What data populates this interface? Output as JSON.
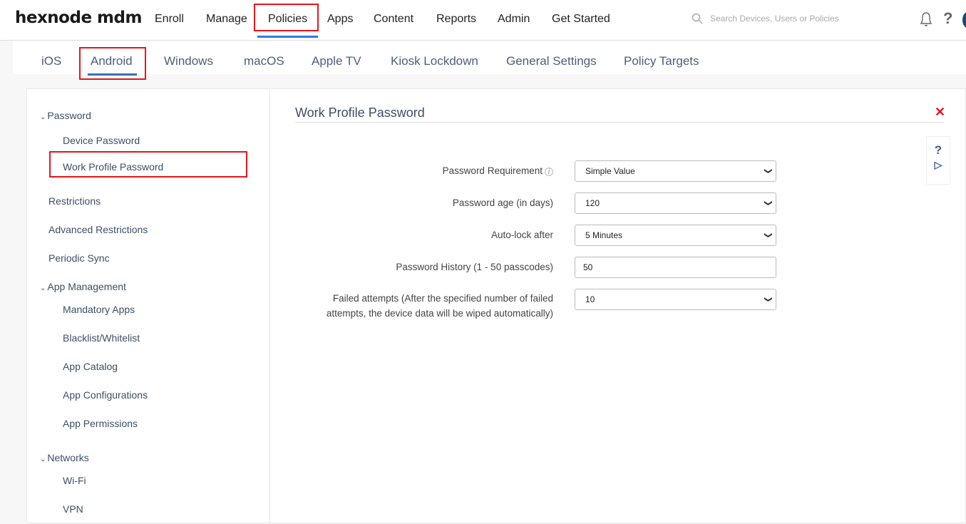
{
  "header": {
    "logo": "hexnode mdm",
    "nav": [
      "Enroll",
      "Manage",
      "Policies",
      "Apps",
      "Content",
      "Reports",
      "Admin",
      "Get Started"
    ],
    "active_nav": "Policies",
    "search_placeholder": "Search Devices, Users or Policies"
  },
  "subtabs": {
    "items": [
      "iOS",
      "Android",
      "Windows",
      "macOS",
      "Apple TV",
      "Kiosk Lockdown",
      "General Settings",
      "Policy Targets"
    ],
    "active": "Android"
  },
  "sidebar": {
    "groups": [
      {
        "label": "Password",
        "expanded": true,
        "items": [
          "Device Password",
          "Work Profile Password"
        ]
      },
      {
        "label": "Restrictions"
      },
      {
        "label": "Advanced Restrictions"
      },
      {
        "label": "Periodic Sync"
      },
      {
        "label": "App Management",
        "expanded": true,
        "items": [
          "Mandatory Apps",
          "Blacklist/Whitelist",
          "App Catalog",
          "App Configurations",
          "App Permissions"
        ]
      },
      {
        "label": "Networks",
        "expanded": true,
        "items": [
          "Wi-Fi",
          "VPN"
        ]
      }
    ],
    "selected": "Work Profile Password"
  },
  "content": {
    "title": "Work Profile Password",
    "fields": [
      {
        "label": "Password Requirement",
        "type": "select",
        "value": "Simple Value",
        "info": true
      },
      {
        "label": "Password age (in days)",
        "type": "select",
        "value": "120"
      },
      {
        "label": "Auto-lock after",
        "type": "select",
        "value": "5 Minutes"
      },
      {
        "label": "Password History (1 - 50 passcodes)",
        "type": "input",
        "value": "50"
      },
      {
        "label": "Failed attempts (After the specified number of failed attempts, the device data will be wiped automatically)",
        "type": "select",
        "value": "10"
      }
    ]
  },
  "colors": {
    "accent": "#2d7be5",
    "highlight": "#e8151b",
    "text_nav": "#3c4f66"
  }
}
